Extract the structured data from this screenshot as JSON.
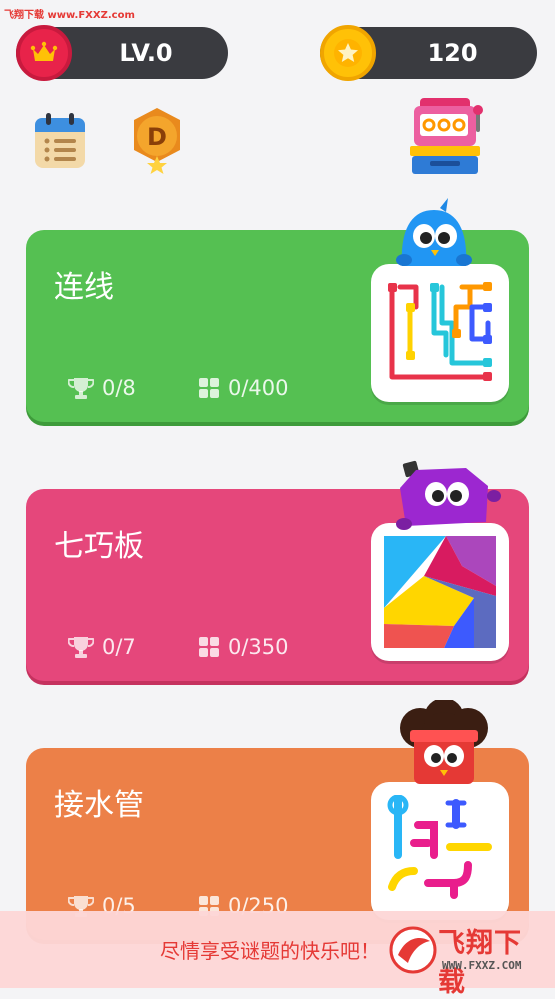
{
  "watermark_top": "飞翔下载 www.FXXZ.com",
  "header": {
    "level_label": "LV.0",
    "coins_value": "120",
    "level_icon": "crown-icon",
    "coin_icon": "star-coin-icon"
  },
  "toolbar": {
    "calendar_icon": "calendar-icon",
    "medal_icon": "medal-d-icon",
    "medal_letter": "D",
    "slot_machine_icon": "slot-machine-icon"
  },
  "games": [
    {
      "title": "连线",
      "trophies": "0/8",
      "levels": "0/400",
      "color": "#55c052"
    },
    {
      "title": "七巧板",
      "trophies": "0/7",
      "levels": "0/350",
      "color": "#e5477b"
    },
    {
      "title": "接水管",
      "trophies": "0/5",
      "levels": "0/250",
      "color": "#ec8048"
    }
  ],
  "banner": {
    "text": "尽情享受谜题的快乐吧！",
    "logo_main": "飞翔下载",
    "logo_sub": "WWW.FXXZ.COM"
  }
}
